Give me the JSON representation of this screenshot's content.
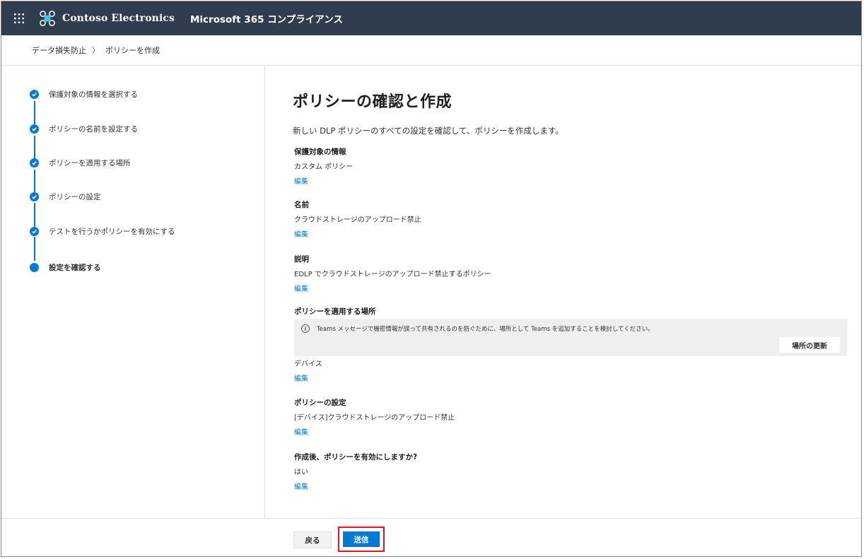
{
  "header": {
    "org_name": "Contoso Electronics",
    "app_name": "Microsoft 365 コンプライアンス",
    "bg_color": "#2f3d4e"
  },
  "breadcrumb": {
    "items": [
      "データ損失防止",
      "ポリシーを作成"
    ],
    "separator": "〉"
  },
  "steps": [
    {
      "label": "保護対象の情報を選択する",
      "status": "completed"
    },
    {
      "label": "ポリシーの名前を設定する",
      "status": "completed"
    },
    {
      "label": "ポリシーを適用する場所",
      "status": "completed"
    },
    {
      "label": "ポリシーの設定",
      "status": "completed"
    },
    {
      "label": "テストを行うかポリシーを有効にする",
      "status": "completed"
    },
    {
      "label": "設定を確認する",
      "status": "current"
    }
  ],
  "main": {
    "title": "ポリシーの確認と作成",
    "subtitle": "新しい DLP ポリシーのすべての設定を確認して、ポリシーを作成します。",
    "edit_label": "編集",
    "sections": {
      "info": {
        "title": "保護対象の情報",
        "value": "カスタム ポリシー"
      },
      "name": {
        "title": "名前",
        "value": "クラウドストレージのアップロード禁止"
      },
      "description": {
        "title": "説明",
        "value": "EDLP でクラウドストレージのアップロード禁止するポリシー"
      },
      "locations": {
        "title": "ポリシーを適用する場所",
        "value": "デバイス"
      },
      "settings": {
        "title": "ポリシーの設定",
        "value": "[デバイス]クラウドストレージのアップロード禁止"
      },
      "enable": {
        "title": "作成後、ポリシーを有効にしますか?",
        "value": "はい"
      }
    },
    "notice": {
      "icon": "info-icon",
      "text": "Teams メッセージで機密情報が誤って共有されるのを防ぐために、場所として Teams を追加することを検討してください。",
      "button_label": "場所の更新"
    }
  },
  "footer": {
    "back_label": "戻る",
    "submit_label": "送信",
    "accent_color": "#0078d4",
    "highlight_color": "#e81123"
  }
}
